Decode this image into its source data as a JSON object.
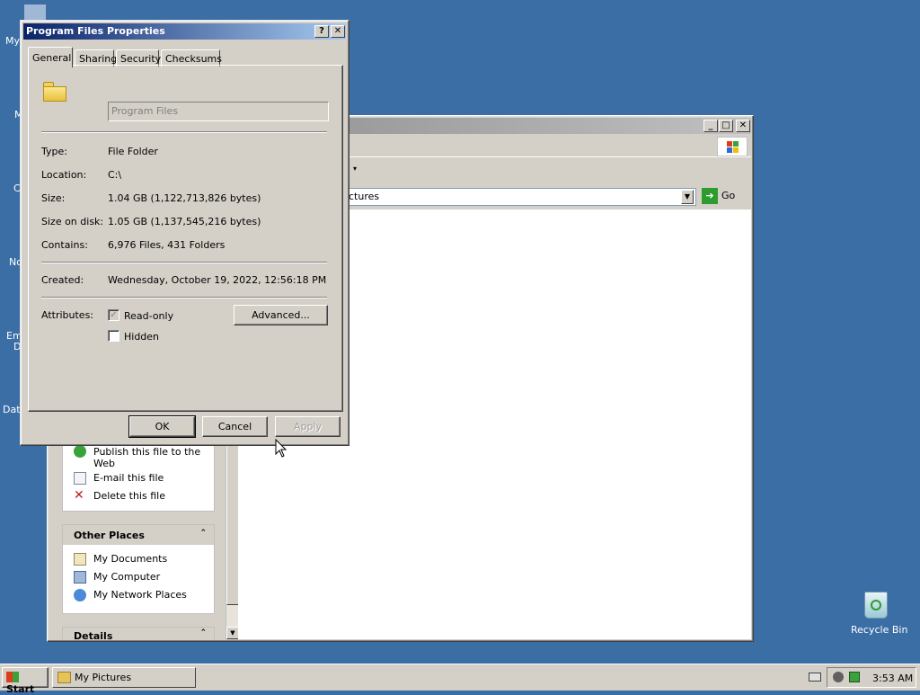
{
  "desktop": {
    "icons": [
      "My",
      "M",
      "C",
      "No",
      "Em",
      "D",
      "Data"
    ],
    "recycle_bin_label": "Recycle Bin"
  },
  "explorer": {
    "address_text": "ctures",
    "go_label": "Go",
    "tasks": {
      "file_items": [
        "Publish this file to the Web",
        "E-mail this file",
        "Delete this file"
      ],
      "other_places_title": "Other Places",
      "other_places_items": [
        "My Documents",
        "My Computer",
        "My Network Places"
      ],
      "details_title": "Details"
    }
  },
  "dialog": {
    "title": "Program Files Properties",
    "help_label": "?",
    "close_label": "✕",
    "tabs": [
      "General",
      "Sharing",
      "Security",
      "Checksums"
    ],
    "active_tab": "General",
    "name_value": "Program Files",
    "type_label": "Type:",
    "type_value": "File Folder",
    "location_label": "Location:",
    "location_value": "C:\\",
    "size_label": "Size:",
    "size_value": "1.04 GB (1,122,713,826 bytes)",
    "size_on_disk_label": "Size on disk:",
    "size_on_disk_value": "1.05 GB (1,137,545,216 bytes)",
    "contains_label": "Contains:",
    "contains_value": "6,976 Files, 431 Folders",
    "created_label": "Created:",
    "created_value": "Wednesday, October 19, 2022, 12:56:18 PM",
    "attributes_label": "Attributes:",
    "readonly_label": "Read-only",
    "readonly_checked": true,
    "hidden_label": "Hidden",
    "hidden_checked": false,
    "advanced_label": "Advanced...",
    "ok_label": "OK",
    "cancel_label": "Cancel",
    "apply_label": "Apply"
  },
  "taskbar": {
    "start_label": "Start",
    "task_label": "My Pictures",
    "clock": "3:53 AM"
  },
  "colors": {
    "desktop": "#3a6ea5",
    "title_active_start": "#0a246a",
    "title_active_end": "#a6caf0"
  }
}
